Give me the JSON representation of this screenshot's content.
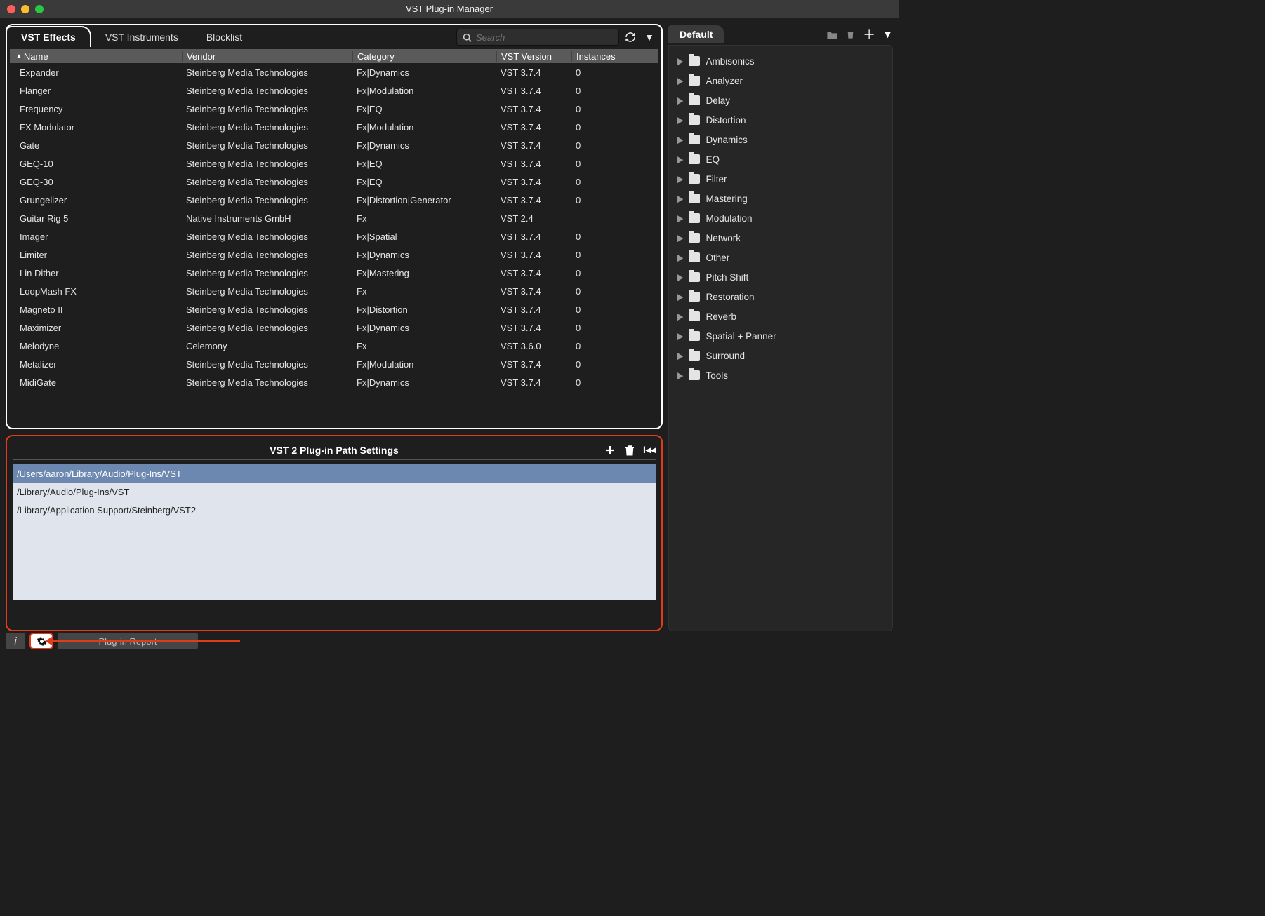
{
  "window": {
    "title": "VST Plug-in Manager"
  },
  "tabs": {
    "effects": "VST Effects",
    "instruments": "VST Instruments",
    "blocklist": "Blocklist"
  },
  "search": {
    "placeholder": "Search"
  },
  "columns": {
    "name": "Name",
    "vendor": "Vendor",
    "category": "Category",
    "version": "VST Version",
    "instances": "Instances"
  },
  "plugins": [
    {
      "name": "Expander",
      "vendor": "Steinberg Media Technologies",
      "category": "Fx|Dynamics",
      "version": "VST 3.7.4",
      "instances": "0"
    },
    {
      "name": "Flanger",
      "vendor": "Steinberg Media Technologies",
      "category": "Fx|Modulation",
      "version": "VST 3.7.4",
      "instances": "0"
    },
    {
      "name": "Frequency",
      "vendor": "Steinberg Media Technologies",
      "category": "Fx|EQ",
      "version": "VST 3.7.4",
      "instances": "0"
    },
    {
      "name": "FX Modulator",
      "vendor": "Steinberg Media Technologies",
      "category": "Fx|Modulation",
      "version": "VST 3.7.4",
      "instances": "0"
    },
    {
      "name": "Gate",
      "vendor": "Steinberg Media Technologies",
      "category": "Fx|Dynamics",
      "version": "VST 3.7.4",
      "instances": "0"
    },
    {
      "name": "GEQ-10",
      "vendor": "Steinberg Media Technologies",
      "category": "Fx|EQ",
      "version": "VST 3.7.4",
      "instances": "0"
    },
    {
      "name": "GEQ-30",
      "vendor": "Steinberg Media Technologies",
      "category": "Fx|EQ",
      "version": "VST 3.7.4",
      "instances": "0"
    },
    {
      "name": "Grungelizer",
      "vendor": "Steinberg Media Technologies",
      "category": "Fx|Distortion|Generator",
      "version": "VST 3.7.4",
      "instances": "0"
    },
    {
      "name": "Guitar Rig 5",
      "vendor": "Native Instruments GmbH",
      "category": "Fx",
      "version": "VST 2.4",
      "instances": ""
    },
    {
      "name": "Imager",
      "vendor": "Steinberg Media Technologies",
      "category": "Fx|Spatial",
      "version": "VST 3.7.4",
      "instances": "0"
    },
    {
      "name": "Limiter",
      "vendor": "Steinberg Media Technologies",
      "category": "Fx|Dynamics",
      "version": "VST 3.7.4",
      "instances": "0"
    },
    {
      "name": "Lin Dither",
      "vendor": "Steinberg Media Technologies",
      "category": "Fx|Mastering",
      "version": "VST 3.7.4",
      "instances": "0"
    },
    {
      "name": "LoopMash FX",
      "vendor": "Steinberg Media Technologies",
      "category": "Fx",
      "version": "VST 3.7.4",
      "instances": "0"
    },
    {
      "name": "Magneto II",
      "vendor": "Steinberg Media Technologies",
      "category": "Fx|Distortion",
      "version": "VST 3.7.4",
      "instances": "0"
    },
    {
      "name": "Maximizer",
      "vendor": "Steinberg Media Technologies",
      "category": "Fx|Dynamics",
      "version": "VST 3.7.4",
      "instances": "0"
    },
    {
      "name": "Melodyne",
      "vendor": "Celemony",
      "category": "Fx",
      "version": "VST 3.6.0",
      "instances": "0"
    },
    {
      "name": "Metalizer",
      "vendor": "Steinberg Media Technologies",
      "category": "Fx|Modulation",
      "version": "VST 3.7.4",
      "instances": "0"
    },
    {
      "name": "MidiGate",
      "vendor": "Steinberg Media Technologies",
      "category": "Fx|Dynamics",
      "version": "VST 3.7.4",
      "instances": "0"
    }
  ],
  "pathSettings": {
    "title": "VST 2 Plug-in Path Settings",
    "paths": [
      "/Users/aaron/Library/Audio/Plug-Ins/VST",
      "/Library/Audio/Plug-Ins/VST",
      "/Library/Application Support/Steinberg/VST2"
    ]
  },
  "collectionTab": "Default",
  "categories": [
    "Ambisonics",
    "Analyzer",
    "Delay",
    "Distortion",
    "Dynamics",
    "EQ",
    "Filter",
    "Mastering",
    "Modulation",
    "Network",
    "Other",
    "Pitch Shift",
    "Restoration",
    "Reverb",
    "Spatial + Panner",
    "Surround",
    "Tools"
  ],
  "footer": {
    "report": "Plug-in Report"
  }
}
